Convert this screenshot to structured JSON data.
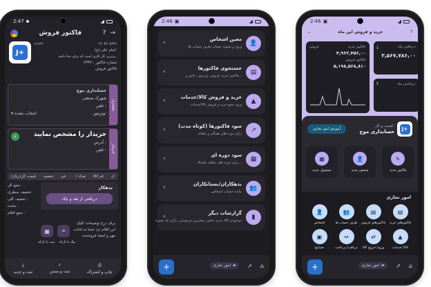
{
  "phone1": {
    "status": {
      "time": "2:47"
    },
    "header": {
      "title": "فاکتور فروش"
    },
    "invoice": {
      "date": "۱۴۰۳/۰۷/۲۶",
      "time": "۱۶:۴۶",
      "line1": "امام علی (ع):",
      "line2": "برترین کار کاری است که برای خدا باشد.",
      "number_label": "شماره فاکتور : ۲۳۳۷",
      "type": "فاکتور فروش"
    },
    "account": {
      "tab": "مشتری",
      "name": "حسابداری موج",
      "city": "شهرک صنعتی",
      "phone": "تلفن :",
      "visitor": "ویزیتور:",
      "visitor_value": "انتخاب نشده"
    },
    "buyer": {
      "tab": "خریدار",
      "title": "خریدار را مشخص نمایید",
      "address": "آدرس :",
      "phone": "تلفن :"
    },
    "table_headers": [
      "ک",
      "نام کالا",
      "تعداد / ۰",
      "فی",
      "تخفیف",
      "قیمت کل(ریال)"
    ],
    "summary": {
      "total": "جمع کل :",
      "row_discount": "تخفیف سطری:",
      "total_discount": "تخفیف کلی :",
      "remain": "مانده :",
      "items": "جمع اقلام :"
    },
    "payment": {
      "debt": "بدهکار",
      "button": "دریافتی از نقد و چک"
    },
    "notes": {
      "line1": "برای درج توضیحات کلیک",
      "line2": "این اقلام نزد شما به امانت",
      "line3": "مهر و امضا فروشنده",
      "line4": "پیک با بارکد",
      "line5": "ثبت با بارکد"
    },
    "bottom": {
      "save_new": "ثبت و جدید",
      "save_close": "ثبت و بستن",
      "print": "چاپ و اشتراک"
    }
  },
  "phone2": {
    "status": {
      "time": "2:46"
    },
    "menu": [
      {
        "title": "معین اشخاص",
        "sub": "ورود و تسویه حساب طرف حساب ها",
        "icon": "person-icon",
        "glyph": "👤"
      },
      {
        "title": "جستجوی فاکتورها",
        "sub": "فاکتور خرید، فروش، ویزیتور، خاص و...",
        "icon": "document-icon",
        "glyph": "▤"
      },
      {
        "title": "خرید و فروش کالا/خدمات",
        "sub": "ورود جمع خرید و فروش کالا/خدمات",
        "icon": "shapes-icon",
        "glyph": "▲"
      },
      {
        "title": "سود فاکتورها (کوتاه مدت)",
        "sub": "برای دوره های هفتگی و ماهانه",
        "icon": "trend-icon",
        "glyph": "↗"
      },
      {
        "title": "سود دوره ای",
        "sub": "برای دوره های ماهانه یکساله...",
        "icon": "calendar-icon",
        "glyph": "▦"
      },
      {
        "title": "بدهکاران/بستانکاران",
        "sub": "مانده حساب اشخاص",
        "icon": "group-icon",
        "glyph": "👥"
      },
      {
        "title": "گزارشات دیگر",
        "sub": "موجودی کالا، خرید خاص، پیشترین مرجوعی، بازای کد تسویه",
        "icon": "bar-chart-icon",
        "glyph": "▮"
      }
    ],
    "nav": {
      "business": "امور تجاری"
    }
  },
  "phone3": {
    "status": {
      "time": "2:46"
    },
    "header": {
      "title": "خرید و فروش این ماه"
    },
    "stats": {
      "received_label": "دریافتی ماه:",
      "received_value": "۳,۵۶۷,۷۸۶,۰۰",
      "paid_label": "پرداختی ماه:",
      "buy_label": "فاکتور خرید:",
      "buy_value": "۴,۹۶۲,۴۵۶,۰۰",
      "sale_label": "فاکتور فروش:",
      "sale_value": "۵,۱۹۸,۵۶۸,۸۱۰",
      "badge": "فروش"
    },
    "biz": {
      "label": "کسب و کار:",
      "name": "حسابداری موج",
      "edu": "آموزش امور تجاری"
    },
    "quick": [
      "فاکتور جدید",
      "شخص جدید",
      "محصول جدید"
    ],
    "section": "امور تجاری",
    "ops": [
      {
        "t": "فاکتورهای خرید",
        "g": "▤"
      },
      {
        "t": "فاکتورهای فروش",
        "g": "▤"
      },
      {
        "t": "طرف حساب ها",
        "g": "👥"
      },
      {
        "t": "اشخاص",
        "g": "👤"
      },
      {
        "t": "کالا/ خدمات",
        "g": "▲"
      },
      {
        "t": "ورود/ خروج کالا",
        "g": "⇄"
      },
      {
        "t": "دریافت/ پرداخت",
        "g": "↔"
      },
      {
        "t": "حسابها",
        "g": "▣"
      }
    ],
    "nav": {
      "business": "امور تجاری"
    }
  }
}
